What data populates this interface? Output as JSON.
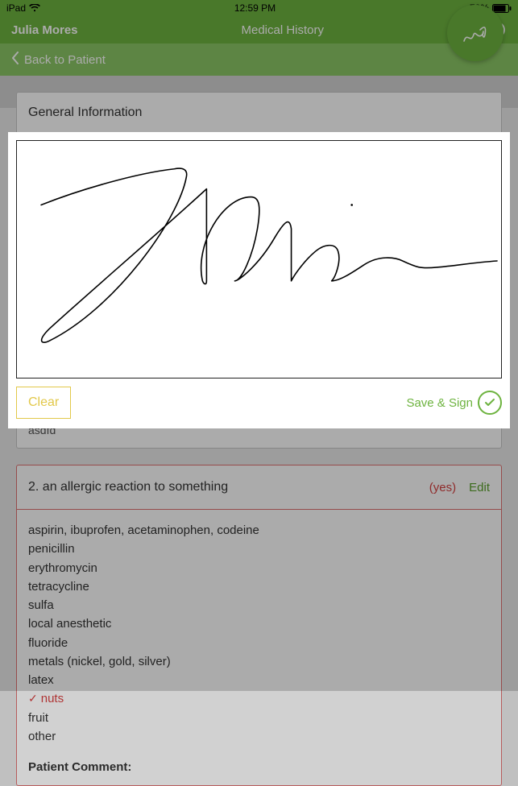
{
  "statusbar": {
    "device": "iPad",
    "time": "12:59 PM",
    "battery": "78%"
  },
  "header": {
    "user": "Julia Mores",
    "title": "Medical History"
  },
  "subheader": {
    "back": "Back to Patient"
  },
  "card1": {
    "title": "General Information",
    "tail": "asdfd"
  },
  "card2": {
    "title": "2. an allergic reaction to something",
    "yes": "(yes)",
    "edit": "Edit",
    "items": {
      "i0": "aspirin, ibuprofen, acetaminophen, codeine",
      "i1": "penicillin",
      "i2": "erythromycin",
      "i3": "tetracycline",
      "i4": "sulfa",
      "i5": "local anesthetic",
      "i6": "fluoride",
      "i7": "metals (nickel, gold, silver)",
      "i8": "latex",
      "i9": "nuts",
      "i10": "fruit",
      "i11": "other"
    },
    "patient_comment_label": "Patient Comment:"
  },
  "modal": {
    "clear": "Clear",
    "save": "Save & Sign"
  }
}
